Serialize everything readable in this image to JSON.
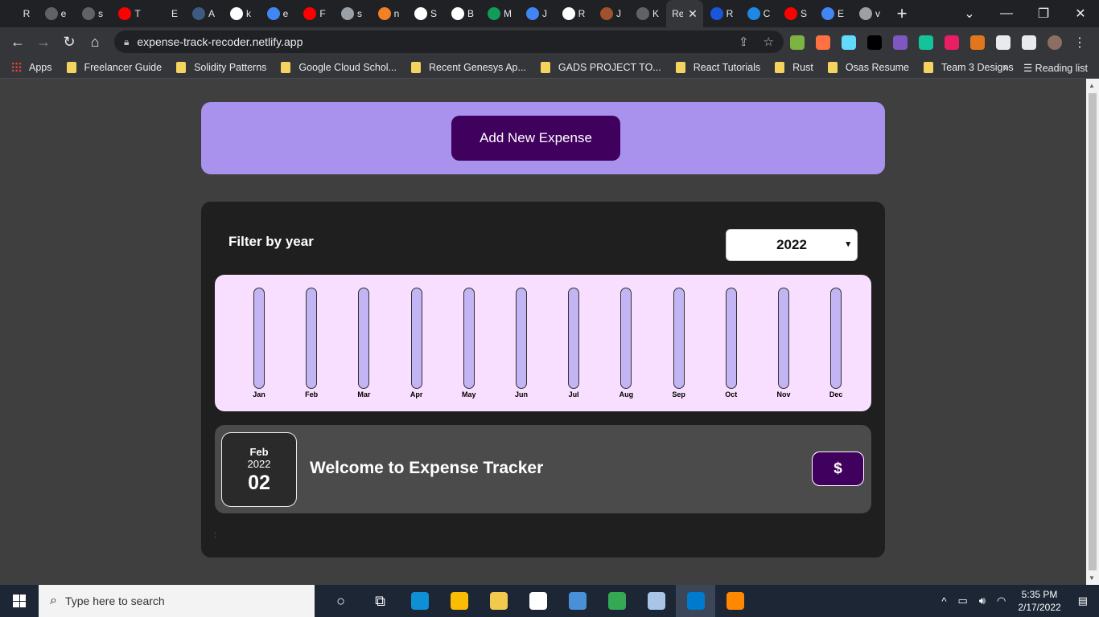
{
  "browser": {
    "tabs": [
      {
        "label": "R",
        "color": "#202124"
      },
      {
        "label": "e",
        "color": "#5f6368"
      },
      {
        "label": "s",
        "color": "#5f6368"
      },
      {
        "label": "T",
        "color": "#ff0000"
      },
      {
        "label": "E",
        "color": "#202124"
      },
      {
        "label": "A",
        "color": "#3d5a80"
      },
      {
        "label": "k",
        "color": "#ffffff"
      },
      {
        "label": "e",
        "color": "#4285f4"
      },
      {
        "label": "F",
        "color": "#ff0000"
      },
      {
        "label": "s",
        "color": "#9aa0a6"
      },
      {
        "label": "n",
        "color": "#f48024"
      },
      {
        "label": "S",
        "color": "#ffffff"
      },
      {
        "label": "B",
        "color": "#ffffff"
      },
      {
        "label": "M",
        "color": "#0f9d58"
      },
      {
        "label": "J",
        "color": "#4285f4"
      },
      {
        "label": "R",
        "color": "#ffffff"
      },
      {
        "label": "J",
        "color": "#a0522d"
      },
      {
        "label": "K",
        "color": "#5f6368"
      }
    ],
    "active_tab": {
      "label": "Re",
      "close": "✕"
    },
    "tabs_after": [
      {
        "label": "R",
        "color": "#1a56db"
      },
      {
        "label": "C",
        "color": "#1e88e5"
      },
      {
        "label": "S",
        "color": "#ff0000"
      },
      {
        "label": "E",
        "color": "#4285f4"
      },
      {
        "label": "v",
        "color": "#9aa0a6"
      }
    ],
    "new_tab": "+",
    "url": "expense-track-recoder.netlify.app",
    "bookmarks": [
      "Freelancer Guide",
      "Solidity Patterns",
      "Google Cloud Schol...",
      "Recent Genesys Ap...",
      "GADS PROJECT TO...",
      "React Tutorials",
      "Rust",
      "Osas Resume",
      "Team 3 Designs"
    ],
    "apps_label": "Apps",
    "more_bookmarks": "»",
    "reading_list": "Reading list",
    "extension_colors": [
      "#7cb342",
      "#ff7043",
      "#61dafb",
      "#000000",
      "#7e57c2",
      "#15c39a",
      "#e91e63",
      "#e2761b",
      "#e8eaed",
      "#e8eaed"
    ]
  },
  "app": {
    "add_button_label": "Add New Expense",
    "filter_label": "Filter by year",
    "selected_year": "2022",
    "chart_data": {
      "type": "bar",
      "categories": [
        "Jan",
        "Feb",
        "Mar",
        "Apr",
        "May",
        "Jun",
        "Jul",
        "Aug",
        "Sep",
        "Oct",
        "Nov",
        "Dec"
      ],
      "values": [
        0,
        0,
        0,
        0,
        0,
        0,
        0,
        0,
        0,
        0,
        0,
        0
      ]
    },
    "expense": {
      "month": "Feb",
      "year": "2022",
      "day": "02",
      "title": "Welcome to Expense Tracker",
      "price": "$"
    }
  },
  "taskbar": {
    "search_placeholder": "Type here to search",
    "time": "5:35 PM",
    "date": "2/17/2022",
    "apps": [
      {
        "name": "cortana",
        "glyph": "○"
      },
      {
        "name": "task-view",
        "glyph": "⧉"
      },
      {
        "name": "edge",
        "color": "#0f8fd6"
      },
      {
        "name": "xampp",
        "color": "#fbbc04"
      },
      {
        "name": "file-explorer",
        "color": "#f2c94c"
      },
      {
        "name": "b-app",
        "color": "#ffffff"
      },
      {
        "name": "git",
        "color": "#4a90d9"
      },
      {
        "name": "chrome",
        "color": "#34a853"
      },
      {
        "name": "image-app",
        "color": "#a8c5e8"
      },
      {
        "name": "vscode",
        "color": "#007acc"
      },
      {
        "name": "vlc",
        "color": "#ff8800"
      }
    ]
  }
}
